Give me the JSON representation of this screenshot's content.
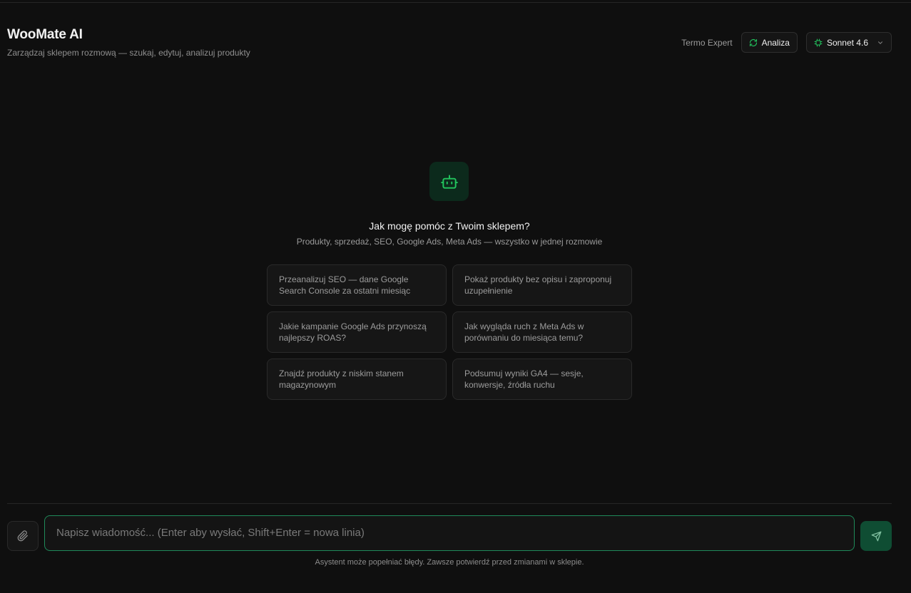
{
  "header": {
    "title": "WooMate AI",
    "subtitle": "Zarządzaj sklepem rozmową — szukaj, edytuj, analizuj produkty",
    "store_name": "Termo Expert",
    "mode_label": "Analiza",
    "model_label": "Sonnet 4.6"
  },
  "icons": {
    "mode": "refresh-icon",
    "model": "cpu-chip-icon",
    "model_dropdown": "chevron-down-icon",
    "welcome": "robot-icon",
    "attach": "paperclip-icon",
    "send": "send-icon"
  },
  "welcome": {
    "heading": "Jak mogę pomóc z Twoim sklepem?",
    "subheading": "Produkty, sprzedaż, SEO, Google Ads, Meta Ads — wszystko w jednej rozmowie"
  },
  "suggestions": [
    "Przeanalizuj SEO — dane Google Search Console za ostatni miesiąc",
    "Pokaż produkty bez opisu i zaproponuj uzupełnienie",
    "Jakie kampanie Google Ads przynoszą najlepszy ROAS?",
    "Jak wygląda ruch z Meta Ads w porównaniu do miesiąca temu?",
    "Znajdź produkty z niskim stanem magazynowym",
    "Podsumuj wyniki GA4 — sesje, konwersje, źródła ruchu"
  ],
  "composer": {
    "placeholder": "Napisz wiadomość... (Enter aby wysłać, Shift+Enter = nowa linia)",
    "value": ""
  },
  "footer": {
    "disclaimer": "Asystent może popełniać błędy. Zawsze potwierdź przed zmianami w sklepie."
  },
  "colors": {
    "background": "#0f0f0f",
    "accent": "#22c55e",
    "accent_dark": "#0f4d33",
    "input_border": "#1f8a5a"
  }
}
